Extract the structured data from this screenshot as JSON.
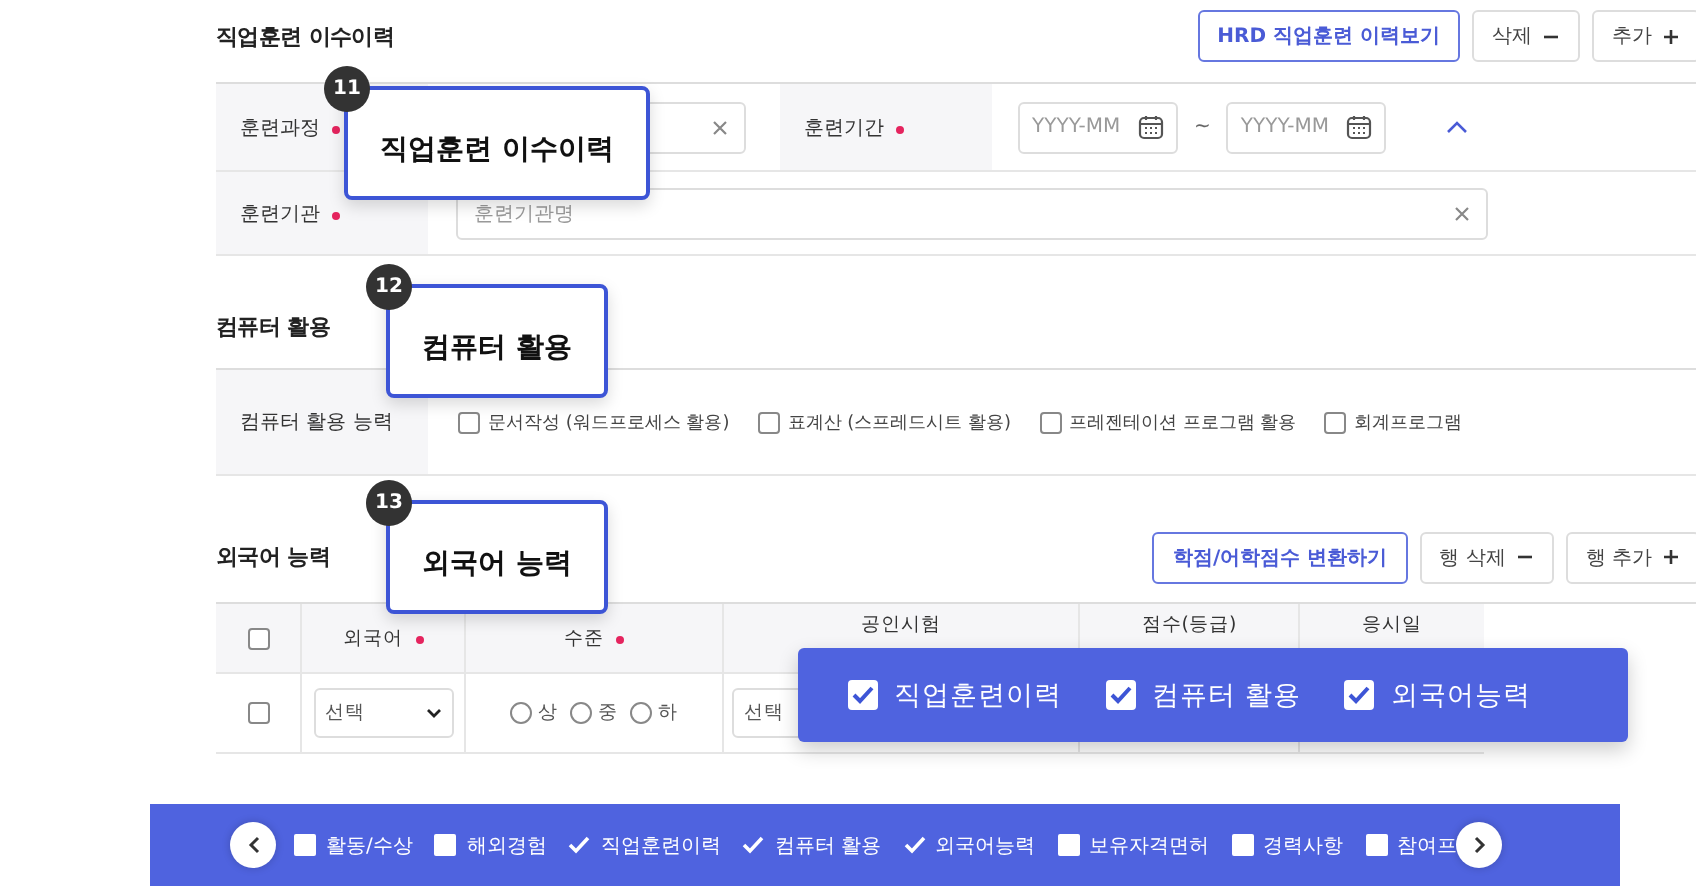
{
  "training": {
    "title": "직업훈련 이수이력",
    "buttons": [
      {
        "label": "HRD 직업훈련 이력보기",
        "kind": "primary"
      },
      {
        "label": "삭제",
        "kind": "remove"
      },
      {
        "label": "추가",
        "kind": "add"
      }
    ],
    "course": {
      "label": "훈련과정",
      "required": true
    },
    "period": {
      "label": "훈련기간",
      "required": true,
      "from": {
        "placeholder": "YYYY-MM"
      },
      "separator": "~",
      "to": {
        "placeholder": "YYYY-MM"
      }
    },
    "expanded": true,
    "institution": {
      "label": "훈련기관",
      "required": true,
      "placeholder": "훈련기관명"
    }
  },
  "computer": {
    "title": "컴퓨터 활용",
    "label": "컴퓨터 활용 능력",
    "options": [
      {
        "label": "문서작성 (워드프로세스 활용)",
        "checked": false
      },
      {
        "label": "표계산 (스프레드시트 활용)",
        "checked": false
      },
      {
        "label": "프레젠테이션 프로그램 활용",
        "checked": false
      },
      {
        "label": "회계프로그램",
        "checked": false
      }
    ]
  },
  "language": {
    "title": "외국어 능력",
    "buttons": [
      {
        "label": "학점/어학점수 변환하기",
        "kind": "primary"
      },
      {
        "label": "행 삭제",
        "kind": "remove"
      },
      {
        "label": "행 추가",
        "kind": "add"
      }
    ],
    "header_checked": false,
    "columns": [
      {
        "label": "외국어",
        "required": true
      },
      {
        "label": "수준",
        "required": true
      },
      {
        "label": "공인시험",
        "required": false
      },
      {
        "label": "점수(등급)",
        "required": false
      },
      {
        "label": "응시일",
        "required": false
      }
    ],
    "rows": [
      {
        "checked": false,
        "language": "선택",
        "levels": [
          {
            "label": "상",
            "selected": false
          },
          {
            "label": "중",
            "selected": false
          },
          {
            "label": "하",
            "selected": false
          }
        ],
        "exam": "선택"
      }
    ]
  },
  "callouts": [
    {
      "number": "11",
      "text": "직업훈련 이수이력"
    },
    {
      "number": "12",
      "text": "컴퓨터 활용"
    },
    {
      "number": "13",
      "text": "외국어 능력"
    }
  ],
  "focus_panel": {
    "items": [
      {
        "label": "직업훈련이력",
        "checked": true
      },
      {
        "label": "컴퓨터 활용",
        "checked": true
      },
      {
        "label": "외국어능력",
        "checked": true
      }
    ]
  },
  "section_bar": {
    "items": [
      {
        "label": "활동/수상",
        "checked": false
      },
      {
        "label": "해외경험",
        "checked": false
      },
      {
        "label": "직업훈련이력",
        "checked": true
      },
      {
        "label": "컴퓨터 활용",
        "checked": true
      },
      {
        "label": "외국어능력",
        "checked": true
      },
      {
        "label": "보유자격면허",
        "checked": false
      },
      {
        "label": "경력사항",
        "checked": false
      },
      {
        "label": "참여프",
        "checked": false
      }
    ]
  }
}
